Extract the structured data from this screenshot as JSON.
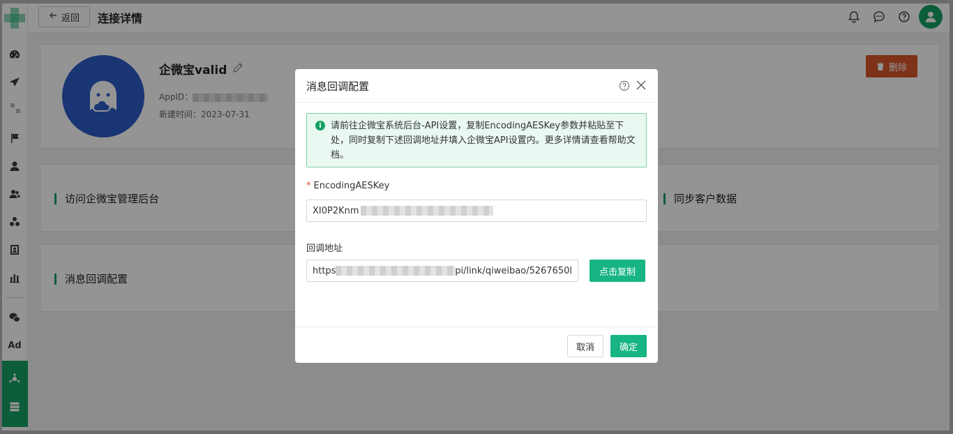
{
  "header": {
    "back_label": "返回",
    "title": "连接详情",
    "icons": [
      "bell-icon",
      "chat-icon",
      "help-icon"
    ]
  },
  "sidebar": {
    "icons": [
      "dashboard-icon",
      "send-icon",
      "flag-icon",
      "user-icon",
      "users-icon",
      "groups-icon",
      "contact-card-icon",
      "bar-chart-icon",
      "wechat-icon",
      "ad-icon",
      "hub-icon",
      "server-icon"
    ],
    "ad_label": "Ad",
    "active_color": "#16a064"
  },
  "profile": {
    "name": "企微宝valid",
    "appid_label": "AppID：",
    "created_label": "新建时间：",
    "created_value": "2023-07-31",
    "delete_label": "删除",
    "avatar_color": "#2b5cc7"
  },
  "sections": {
    "visit_admin": "访问企微宝管理后台",
    "sync_customers": "同步客户数据",
    "callback_config": "消息回调配置"
  },
  "modal": {
    "title": "消息回调配置",
    "alert": "请前往企微宝系统后台-API设置，复制EncodingAESKey参数并粘贴至下处，同时复制下述回调地址并填入企微宝API设置内。更多详情请查看帮助文档。",
    "aes_label": "EncodingAESKey",
    "aes_required_mark": "*",
    "aes_value_prefix": "XI0P2Knm",
    "callback_label": "回调地址",
    "callback_prefix": "https",
    "callback_suffix": "pi/link/qiweibao/5267650l",
    "copy_label": "点击复制",
    "cancel_label": "取消",
    "ok_label": "确定"
  },
  "colors": {
    "accent": "#17b583",
    "danger": "#d9572b",
    "alert_bg": "#e9f8f0"
  }
}
